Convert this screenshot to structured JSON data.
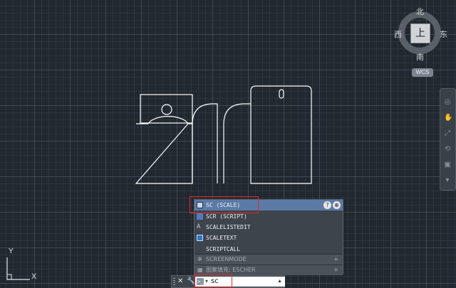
{
  "viewcube": {
    "north": "北",
    "south": "南",
    "west": "西",
    "east": "东",
    "face": "上",
    "wcs": "WCS"
  },
  "ucs": {
    "y_label": "Y",
    "x_label": "X"
  },
  "autocomplete": {
    "selected": "SC (SCALE)",
    "items": [
      "SCR (SCRIPT)",
      "SCALELISTEDIT",
      "SCALETEXT",
      "SCRIPTCALL"
    ],
    "groups": [
      "SCREENMODE",
      "图案填充: ESCHER"
    ],
    "help_icon": "?",
    "globe_icon": "⊕"
  },
  "commandline": {
    "input_value": "sc",
    "prompt_icon": ">_",
    "caret": "▾"
  },
  "colors": {
    "highlight": "#e8262a",
    "selected_row": "#5b7aa6",
    "drawing_lines": "#ffffff"
  }
}
